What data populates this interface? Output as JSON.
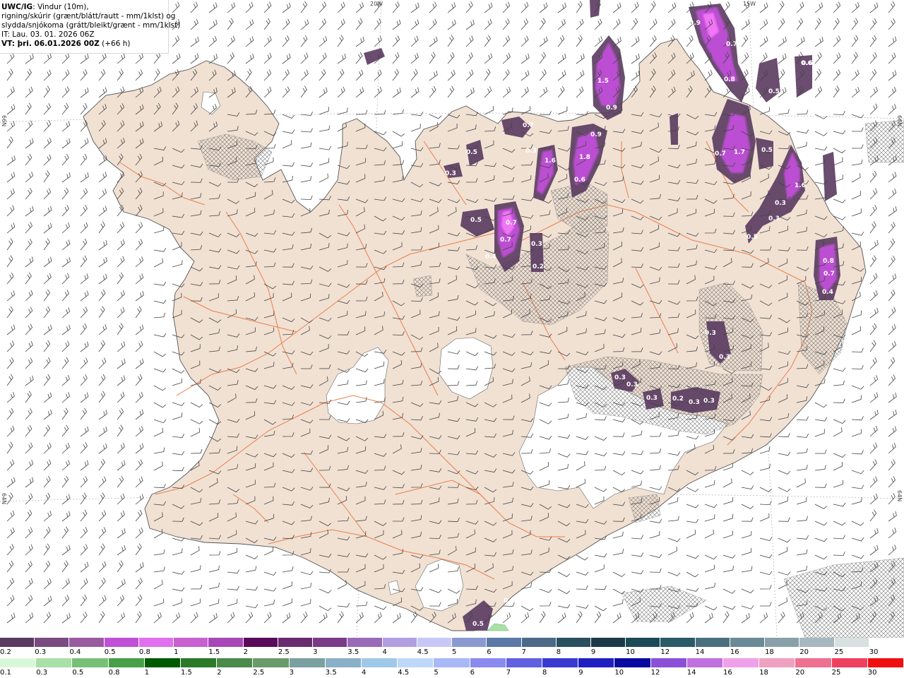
{
  "header": {
    "brand": "UWC/IG",
    "line1_rest": ": Vindur (10m),",
    "line2": "rigning/skúrir (grænt/blátt/rautt - mm/1klst) og",
    "line3": "slydda/snjókoma (grátt/bleikt/grænt - mm/1klst)",
    "line4": "IT: Lau. 03. 01. 2026 06Z",
    "line5_bold": "VT: þri. 06.01.2026 00Z",
    "line5_rest": " (+66 h)"
  },
  "coords": {
    "w20": "20W",
    "w15": "15W",
    "n66_left": "66N",
    "n66_right": "66N",
    "n64_left": "64N",
    "n64_right": "64N"
  },
  "colors": {
    "land": "#f1e1d3",
    "roads": "#e8743f",
    "coast": "#555555",
    "glacier": "#ffffff",
    "snow_purple": "#c050d8",
    "snow_dark": "#5a3a60"
  },
  "precip_labels": [
    {
      "v": "0.9"
    },
    {
      "v": "0.7"
    },
    {
      "v": "0.4"
    },
    {
      "v": "0.6"
    },
    {
      "v": "0.8"
    },
    {
      "v": "0.5"
    },
    {
      "v": "1.5"
    },
    {
      "v": "0.9"
    },
    {
      "v": "0.7"
    },
    {
      "v": "0.9"
    },
    {
      "v": "1.8"
    },
    {
      "v": "0.6"
    },
    {
      "v": "1.6"
    },
    {
      "v": "0.3"
    },
    {
      "v": "0.5"
    },
    {
      "v": "0.3"
    },
    {
      "v": "0.7"
    },
    {
      "v": "1.7"
    },
    {
      "v": "0.5"
    },
    {
      "v": "1.6"
    },
    {
      "v": "0.3"
    },
    {
      "v": "0.3"
    },
    {
      "v": "0.5"
    },
    {
      "v": "0.5"
    },
    {
      "v": "0.7"
    },
    {
      "v": "0.7"
    },
    {
      "v": "0.4"
    },
    {
      "v": "0.3"
    },
    {
      "v": "0.2"
    },
    {
      "v": "0.8"
    },
    {
      "v": "0.7"
    },
    {
      "v": "0.4"
    },
    {
      "v": "0.3"
    },
    {
      "v": "0.3"
    },
    {
      "v": "0.3"
    },
    {
      "v": "0.3"
    },
    {
      "v": "0.3"
    },
    {
      "v": "0.2"
    },
    {
      "v": "0.3"
    },
    {
      "v": "0.3"
    },
    {
      "v": "0.3"
    },
    {
      "v": "0.3"
    },
    {
      "v": "0.5"
    },
    {
      "v": "0.2"
    },
    {
      "v": "0.6"
    }
  ],
  "legend": {
    "snow": {
      "labels": [
        "0.2",
        "0.3",
        "0.4",
        "0.5",
        "0.8",
        "1",
        "1.5",
        "2",
        "2.5",
        "3",
        "3.5",
        "4",
        "4.5",
        "5",
        "6",
        "7",
        "8",
        "9",
        "10",
        "12",
        "14",
        "16",
        "18",
        "20",
        "25",
        "30"
      ],
      "colors": [
        "#5a3a60",
        "#7a4a80",
        "#9a5aa0",
        "#c050d8",
        "#e070f0",
        "#c860d0",
        "#a848b8",
        "#5a0a5a",
        "#6a2a70",
        "#7a3a88",
        "#9a6ab8",
        "#b0a0e0",
        "#c8c8f8",
        "#8a9ad0",
        "#5a78a8",
        "#4a6a88",
        "#2a5060",
        "#1a3a48",
        "#1a4a58",
        "#2a5a68",
        "#4a7080",
        "#6a8a98",
        "#8aa0a8",
        "#a8b8c0",
        "#d8e0e0"
      ]
    },
    "rain": {
      "labels": [
        "0.1",
        "0.3",
        "0.5",
        "0.8",
        "1",
        "1.5",
        "2",
        "2.5",
        "3",
        "3.5",
        "4",
        "4.5",
        "5",
        "6",
        "7",
        "8",
        "9",
        "10",
        "12",
        "14",
        "16",
        "18",
        "20",
        "25",
        "30"
      ],
      "colors": [
        "#d8f8d8",
        "#a8e0a8",
        "#78c078",
        "#48a048",
        "#005a00",
        "#2a7a2a",
        "#4a8a4a",
        "#6a9a6a",
        "#7aa0a0",
        "#8ab0c8",
        "#a0c8e8",
        "#c0d8f8",
        "#a8b8f8",
        "#8a8af0",
        "#6060e0",
        "#3a3ad0",
        "#2020c0",
        "#0a0aa0",
        "#8a50d8",
        "#c070e0",
        "#f0a0e8",
        "#f0a0c0",
        "#f07090",
        "#f04060",
        "#f01010"
      ]
    }
  }
}
